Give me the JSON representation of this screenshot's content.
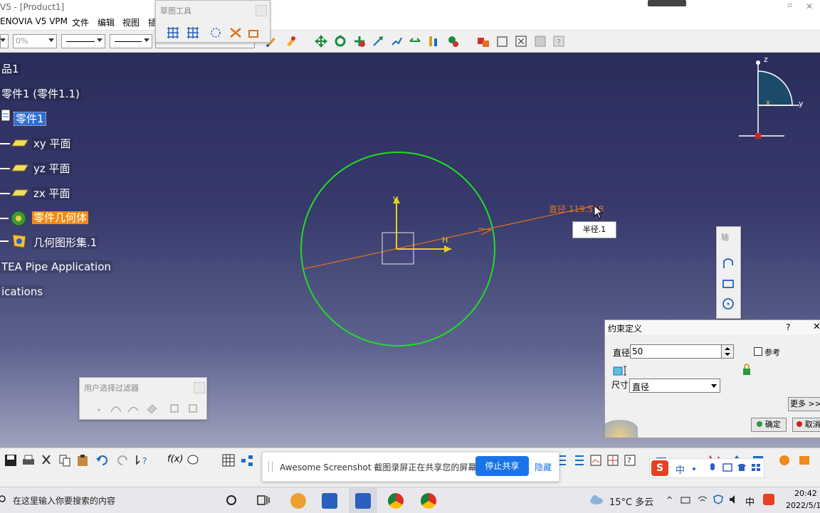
{
  "window": {
    "title": "V5 - [Product1]"
  },
  "menu": {
    "items": [
      "ENOVIA V5 VPM",
      "文件",
      "编辑",
      "视图",
      "插"
    ]
  },
  "toolbar": {
    "percent": "0%"
  },
  "sketch_tools": {
    "title": "草图工具"
  },
  "tree": {
    "items": [
      {
        "label": "品1"
      },
      {
        "label": "零件1 (零件1.1)"
      },
      {
        "label": "零件1"
      },
      {
        "label": "xy 平面"
      },
      {
        "label": "yz 平面"
      },
      {
        "label": "zx 平面"
      },
      {
        "label": "零件几何体"
      },
      {
        "label": "几何图形集.1"
      },
      {
        "label": "TEA Pipe Application"
      },
      {
        "label": "ications"
      }
    ]
  },
  "sketch": {
    "dimension_label": "直径 119.518",
    "tooltip": "半径.1",
    "axis_v": "V",
    "axis_h": "H"
  },
  "compass": {
    "z": "z",
    "y": "y",
    "x": "x"
  },
  "filter_panel": {
    "title": "用户选择过滤器"
  },
  "side_panel": {
    "title": "轴"
  },
  "dialog": {
    "title": "约束定义",
    "help": "?",
    "close": "✕",
    "diameter_label": "直径",
    "diameter_value": "50",
    "reference_label": "参考",
    "dimension_label": "尺寸",
    "dimension_value": "直径",
    "more_button": "更多 >>",
    "ok_button": "确定",
    "cancel_button": "取消"
  },
  "share": {
    "message": "Awesome Screenshot 截图录屏正在共享您的屏幕。",
    "stop_button": "停止共享",
    "hide_link": "隐藏"
  },
  "ime": {
    "lang": "中"
  },
  "taskbar": {
    "search_placeholder": "在这里输入你要搜索的内容",
    "weather": "15°C  多云",
    "input_lang": "中",
    "time": "20:42",
    "date": "2022/5/1"
  }
}
